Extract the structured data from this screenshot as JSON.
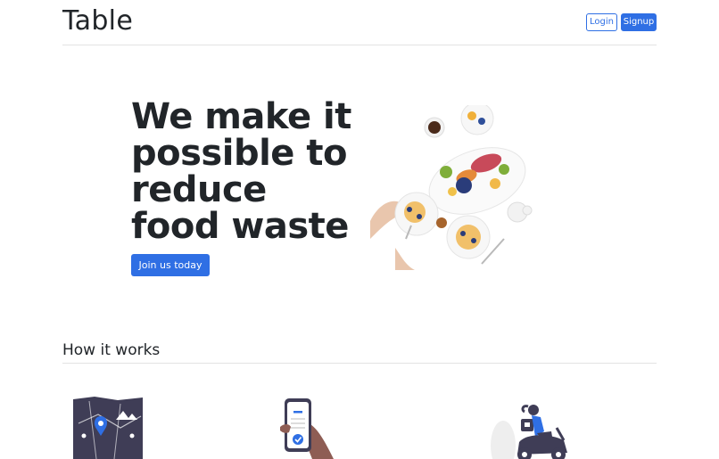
{
  "header": {
    "brand": "Table",
    "login_label": "Login",
    "signup_label": "Signup"
  },
  "hero": {
    "title": "We make it possible to reduce food waste",
    "cta_label": "Join us today",
    "image": "food-table-photo"
  },
  "how_it_works": {
    "title": "How it works",
    "steps": [
      {
        "icon": "map-pin-illustration"
      },
      {
        "icon": "phone-check-illustration"
      },
      {
        "icon": "scooter-delivery-illustration"
      }
    ]
  },
  "colors": {
    "primary": "#2f6fe4",
    "text": "#212529",
    "divider": "#e3e3e3",
    "illustration_dark": "#3f3d56"
  }
}
